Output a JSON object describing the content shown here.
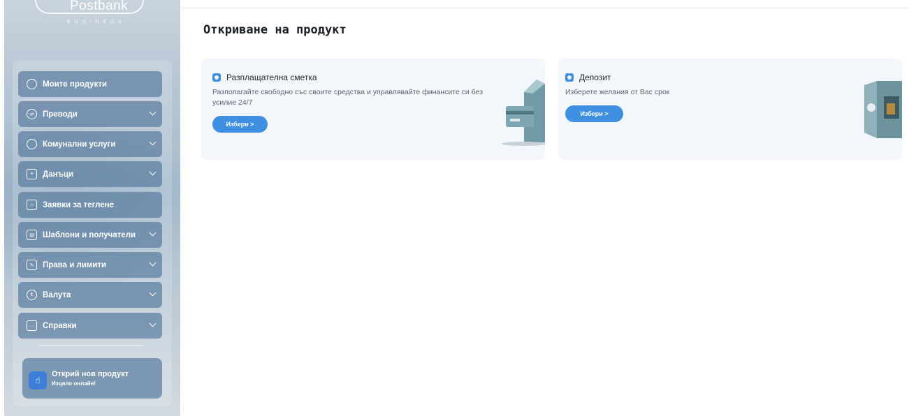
{
  "brand": {
    "name": "Postbank",
    "sub": "BUSINESS"
  },
  "sidebar": {
    "items": [
      {
        "label": "Моите продукти",
        "icon": "home-icon",
        "expandable": false
      },
      {
        "label": "Преводи",
        "icon": "transfer-icon",
        "expandable": true
      },
      {
        "label": "Комунални услуги",
        "icon": "bulb-icon",
        "expandable": true
      },
      {
        "label": "Данъци",
        "icon": "document-icon",
        "expandable": true
      },
      {
        "label": "Заявки за теглене",
        "icon": "bank-icon",
        "expandable": false
      },
      {
        "label": "Шаблони и получатели",
        "icon": "clipboard-icon",
        "expandable": true
      },
      {
        "label": "Права и лимити",
        "icon": "permissions-icon",
        "expandable": true
      },
      {
        "label": "Валута",
        "icon": "currency-icon",
        "expandable": true
      },
      {
        "label": "Справки",
        "icon": "reports-icon",
        "expandable": true
      }
    ],
    "promo": {
      "title": "Открий нов продукт",
      "subtitle": "Изцяло онлайн!"
    }
  },
  "main": {
    "title": "Откриване на продукт",
    "cards": [
      {
        "title": "Разплащателна сметка",
        "description": "Разполагайте свободно със своите средства и управлявайте финансите си без усилие 24/7",
        "button": "Избери  >"
      },
      {
        "title": "Депозит",
        "description": "Изберете желания от Вас срок",
        "button": "Избери  >"
      }
    ]
  },
  "colors": {
    "accent": "#3f8fe3",
    "sidebar_item": "#5a7da0",
    "card_bg": "#f3f6fa"
  }
}
